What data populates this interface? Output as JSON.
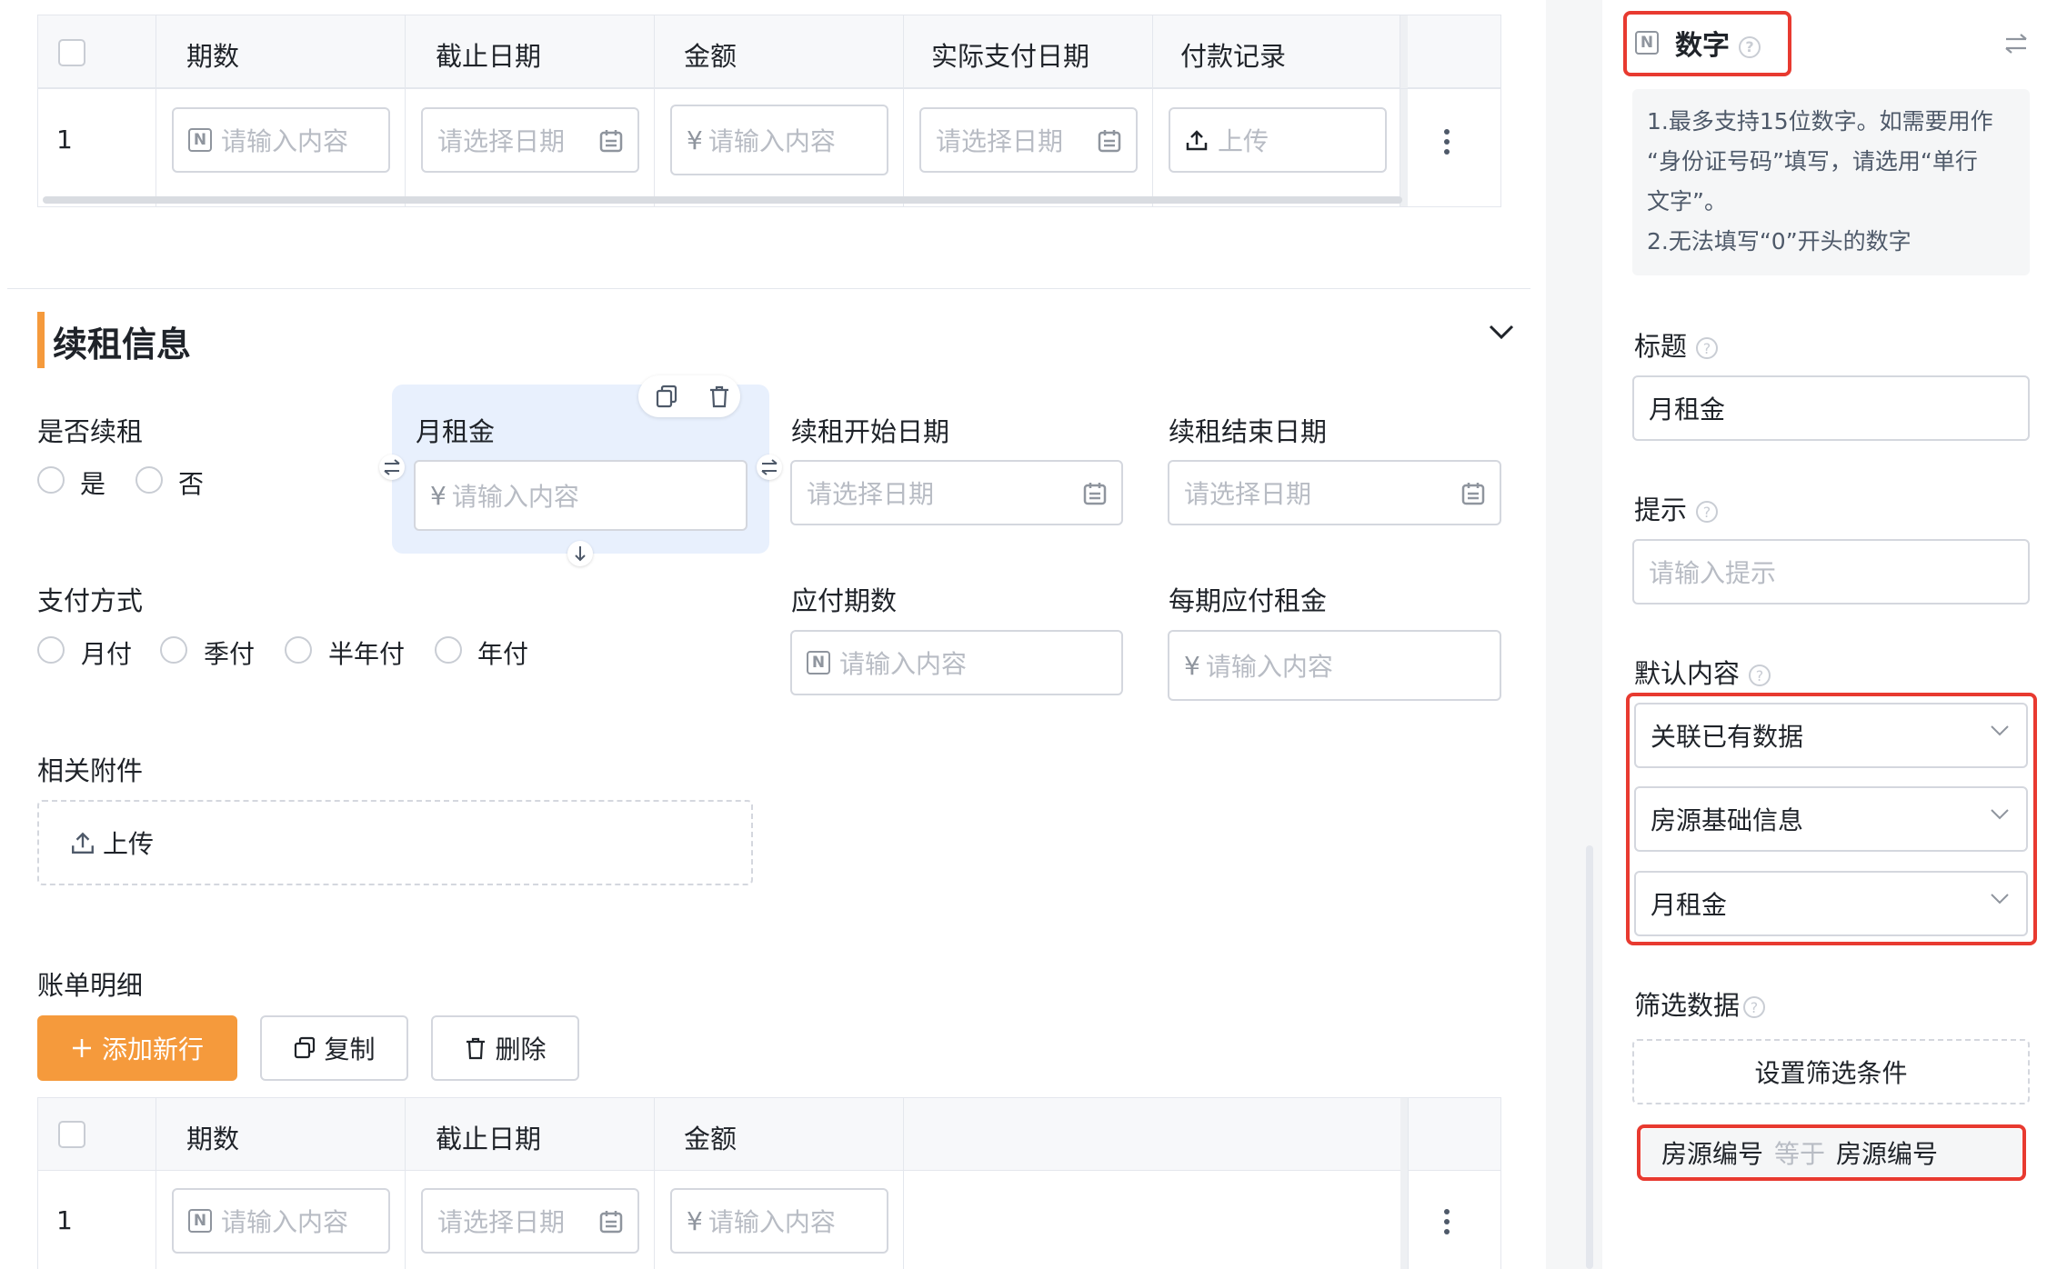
{
  "top_table": {
    "headers": [
      "期数",
      "截止日期",
      "金额",
      "实际支付日期",
      "付款记录"
    ],
    "row_index": "1",
    "num_placeholder": "请输入内容",
    "date_placeholder": "请选择日期",
    "amount_placeholder": "请输入内容",
    "currency": "¥",
    "upload_label": "上传"
  },
  "section": {
    "title": "续租信息",
    "accent_color": "#f59a3c"
  },
  "form": {
    "renew": {
      "label": "是否续租",
      "options": [
        "是",
        "否"
      ]
    },
    "monthly_rent": {
      "label": "月租金",
      "placeholder": "请输入内容",
      "currency": "¥"
    },
    "start_date": {
      "label": "续租开始日期",
      "placeholder": "请选择日期"
    },
    "end_date": {
      "label": "续租结束日期",
      "placeholder": "请选择日期"
    },
    "pay_method": {
      "label": "支付方式",
      "options": [
        "月付",
        "季付",
        "半年付",
        "年付"
      ]
    },
    "periods": {
      "label": "应付期数",
      "placeholder": "请输入内容"
    },
    "rent_per_period": {
      "label": "每期应付租金",
      "placeholder": "请输入内容",
      "currency": "¥"
    },
    "attachments": {
      "label": "相关附件",
      "upload": "上传"
    }
  },
  "bill": {
    "label": "账单明细",
    "add_row": "添加新行",
    "copy": "复制",
    "delete": "删除",
    "headers": [
      "期数",
      "截止日期",
      "金额"
    ],
    "row_index": "1",
    "num_placeholder": "请输入内容",
    "date_placeholder": "请选择日期",
    "amount_placeholder": "请输入内容",
    "currency": "¥"
  },
  "panel": {
    "field_type": "数字",
    "tips": [
      "1.最多支持15位数字。如需要用作",
      "“身份证号码”填写，请选用“单行",
      "文字”。",
      "2.无法填写“0”开头的数字"
    ],
    "title_label": "标题",
    "title_value": "月租金",
    "hint_label": "提示",
    "hint_placeholder": "请输入提示",
    "default_label": "默认内容",
    "default_selects": [
      "关联已有数据",
      "房源基础信息",
      "月租金"
    ],
    "filter_label": "筛选数据",
    "filter_button": "设置筛选条件",
    "condition": {
      "left": "房源编号",
      "op": "等于",
      "right": "房源编号"
    }
  },
  "colors": {
    "primary_orange": "#f59a3c",
    "highlight_red": "#e83a30",
    "selected_bg": "#e8f0fd"
  }
}
